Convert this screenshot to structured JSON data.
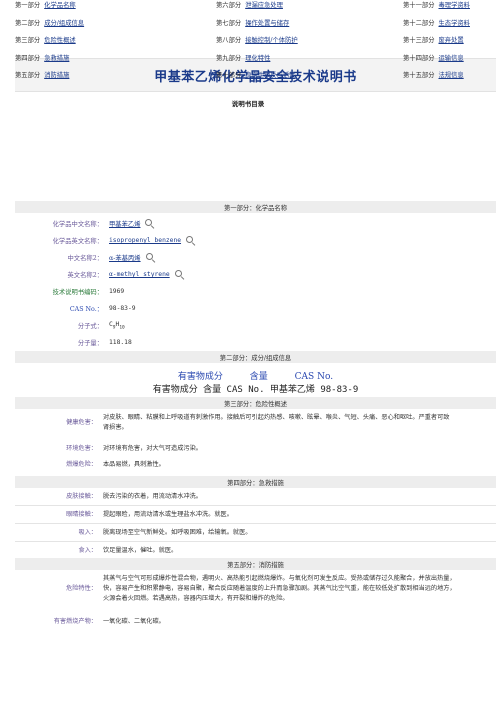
{
  "title": "甲基苯乙烯化学品安全技术说明书",
  "toc": {
    "title": "说明书目录",
    "items": [
      {
        "num": "第一部分",
        "label": "化学品名称"
      },
      {
        "num": "第二部分",
        "label": "成分/组成信息"
      },
      {
        "num": "第三部分",
        "label": "危险性概述"
      },
      {
        "num": "第四部分",
        "label": "急救措施"
      },
      {
        "num": "第五部分",
        "label": "消防措施"
      },
      {
        "num": "第六部分",
        "label": "泄漏应急处理"
      },
      {
        "num": "第七部分",
        "label": "操作处置与储存"
      },
      {
        "num": "第八部分",
        "label": "接触控制/个体防护"
      },
      {
        "num": "第九部分",
        "label": "理化特性"
      },
      {
        "num": "第十部分",
        "label": "稳定性和反应活性"
      },
      {
        "num": "第十一部分",
        "label": "毒理学资料"
      },
      {
        "num": "第十二部分",
        "label": "生态学资料"
      },
      {
        "num": "第十三部分",
        "label": "废弃处置"
      },
      {
        "num": "第十四部分",
        "label": "运输信息"
      },
      {
        "num": "第十五部分",
        "label": "法规信息"
      }
    ]
  },
  "sections": {
    "s1": "第一部分：化学品名称",
    "s2": "第二部分：成分/组成信息",
    "s3": "第三部分：危险性概述",
    "s4": "第四部分：急救措施",
    "s5": "第五部分：消防措施"
  },
  "part1": {
    "cn_name_label": "化学品中文名称：",
    "cn_name": "甲基苯乙烯",
    "en_name_label": "化学品英文名称：",
    "en_name": "isopropenyl benzene",
    "cn_name2_label": "中文名称2：",
    "cn_name2": "α-苯基丙烯",
    "en_name2_label": "英文名称2：",
    "en_name2": "α-methyl styrene",
    "tech_no_label": "技术说明书编码：",
    "tech_no": "1969",
    "cas_label": "CAS No.：",
    "cas": "98-83-9",
    "formula_label": "分子式：",
    "formula_main": "C",
    "formula_sub1": "9",
    "formula_h": "H",
    "formula_sub2": "10",
    "mw_label": "分子量：",
    "mw": "118.18"
  },
  "part2": {
    "h1": "有害物成分",
    "h2": "含量",
    "h3": "CAS No.",
    "line": "有害物成分 含量 CAS No. 甲基苯乙烯 98-83-9"
  },
  "part3": {
    "health_label": "健康危害：",
    "health_1": "对皮肤、眼睛、粘膜和上呼吸道有刺激作用。接触后可引起灼热感、咳嗽、眩晕、喉炎、气短、头痛、恶心和呕吐。严重者可致",
    "health_2": "肾损害。",
    "env_label": "环境危害：",
    "env": "对环境有危害，对大气可造成污染。",
    "fire_label": "燃爆危险：",
    "fire": "本品易燃，具刺激性。"
  },
  "part4": {
    "skin_label": "皮肤接触：",
    "skin": "脱去污染的衣着，用流动清水冲洗。",
    "eye_label": "眼睛接触：",
    "eye": "提起眼睑，用流动清水或生理盐水冲洗。就医。",
    "inhale_label": "吸入：",
    "inhale": "脱离现场至空气新鲜处。如呼吸困难，给输氧。就医。",
    "ingest_label": "食入：",
    "ingest": "饮足量温水，催吐。就医。"
  },
  "part5": {
    "hazard_label": "危险特性：",
    "hazard_1": "其蒸气与空气可形成爆炸性混合物，遇明火、高热能引起燃烧爆炸。与氧化剂可发生反应。受热或储存过久能聚合，并放出热量，",
    "hazard_2": "快，容易产生和积累静电，容易自聚，聚合反应随着温度的上升而急骤加剧。其蒸气比空气重，能在较低处扩散到相当远的地方，",
    "hazard_3": "火源会着火回燃。若遇高热，容器内压增大，有开裂和爆炸的危险。",
    "products_label": "有害燃烧产物：",
    "products": "一氧化碳、二氧化碳。"
  }
}
